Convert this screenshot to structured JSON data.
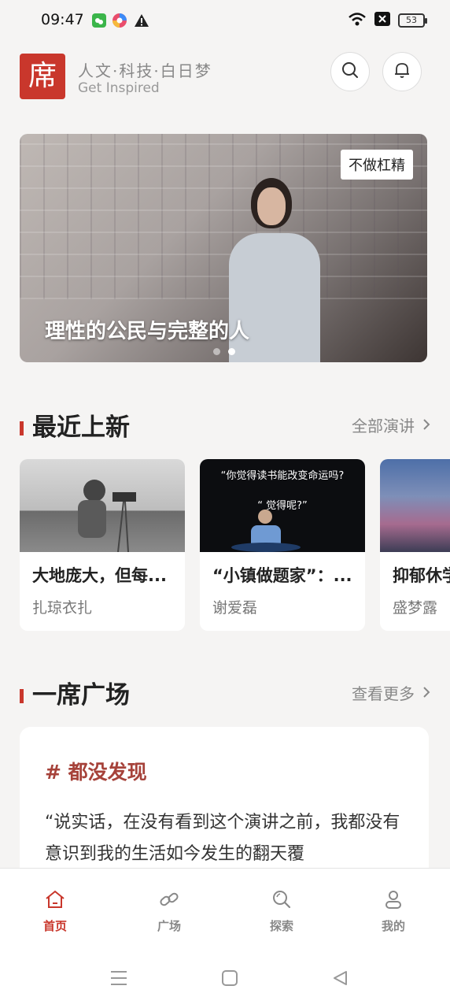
{
  "status_bar": {
    "time": "09:47",
    "battery": "53"
  },
  "header": {
    "logo_char": "席",
    "slogan": "人文·科技·白日梦",
    "slogan_en": "Get Inspired"
  },
  "banner": {
    "tag": "不做杠精",
    "title": "理性的公民与完整的人",
    "slide_count": 2,
    "active_slide": 2
  },
  "recent": {
    "title": "最近上新",
    "more_label": "全部演讲",
    "cards": [
      {
        "title": "大地庞大，但每...",
        "author": "扎琼衣扎"
      },
      {
        "title": "“小镇做题家”：...",
        "author": "谢爱磊",
        "thumb_text_1": "“你觉得读书能改变命运吗?",
        "thumb_text_2": "“  觉得呢?”"
      },
      {
        "title": "抑郁休学",
        "author": "盛梦露"
      }
    ]
  },
  "square": {
    "title": "一席广场",
    "more_label": "查看更多",
    "post": {
      "topic": "# 都没发现",
      "text": "“说实话，在没有看到这个演讲之前，我都没有意识到我的生活如今发生的翻天覆"
    }
  },
  "tabbar": {
    "items": [
      {
        "label": "首页",
        "icon": "home-icon",
        "active": true
      },
      {
        "label": "广场",
        "icon": "link-icon",
        "active": false
      },
      {
        "label": "探索",
        "icon": "explore-icon",
        "active": false
      },
      {
        "label": "我的",
        "icon": "profile-icon",
        "active": false
      }
    ]
  },
  "colors": {
    "brand": "#c9372c",
    "topic": "#a6423a"
  }
}
